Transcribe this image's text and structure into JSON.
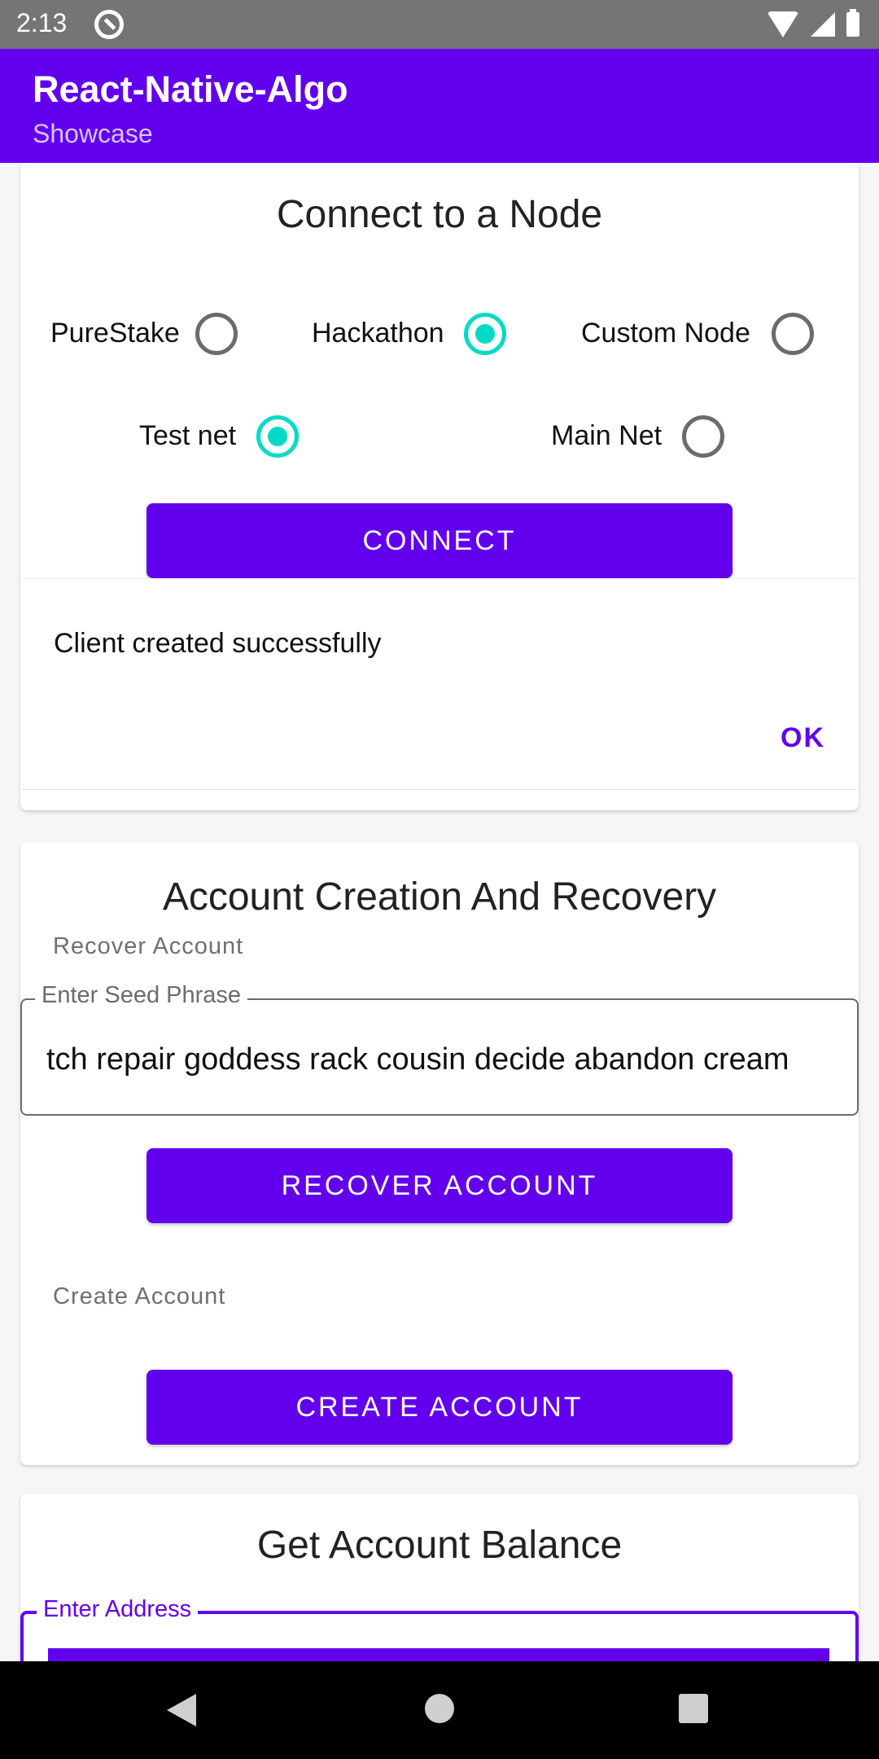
{
  "status_bar": {
    "time": "2:13"
  },
  "app_bar": {
    "title": "React-Native-Algo",
    "subtitle": "Showcase"
  },
  "connect_card": {
    "title": "Connect to a Node",
    "providers": [
      {
        "label": "PureStake",
        "selected": false
      },
      {
        "label": "Hackathon",
        "selected": true
      },
      {
        "label": "Custom Node",
        "selected": false
      }
    ],
    "networks": [
      {
        "label": "Test net",
        "selected": true
      },
      {
        "label": "Main Net",
        "selected": false
      }
    ],
    "connect_button": "CONNECT"
  },
  "dialog": {
    "message": "Client created successfully",
    "ok_label": "OK"
  },
  "account_card": {
    "title": "Account Creation And Recovery",
    "recover_label": "Recover Account",
    "seed_field_label": "Enter Seed Phrase",
    "seed_field_value": "tch repair goddess rack cousin decide abandon cream",
    "recover_button": "RECOVER ACCOUNT",
    "create_label": "Create Account",
    "create_button": "CREATE ACCOUNT"
  },
  "balance_card": {
    "title": "Get Account Balance",
    "address_field_label": "Enter Address"
  },
  "colors": {
    "primary": "#6200ee",
    "accent": "#03dac5",
    "status_bar": "#757575"
  }
}
